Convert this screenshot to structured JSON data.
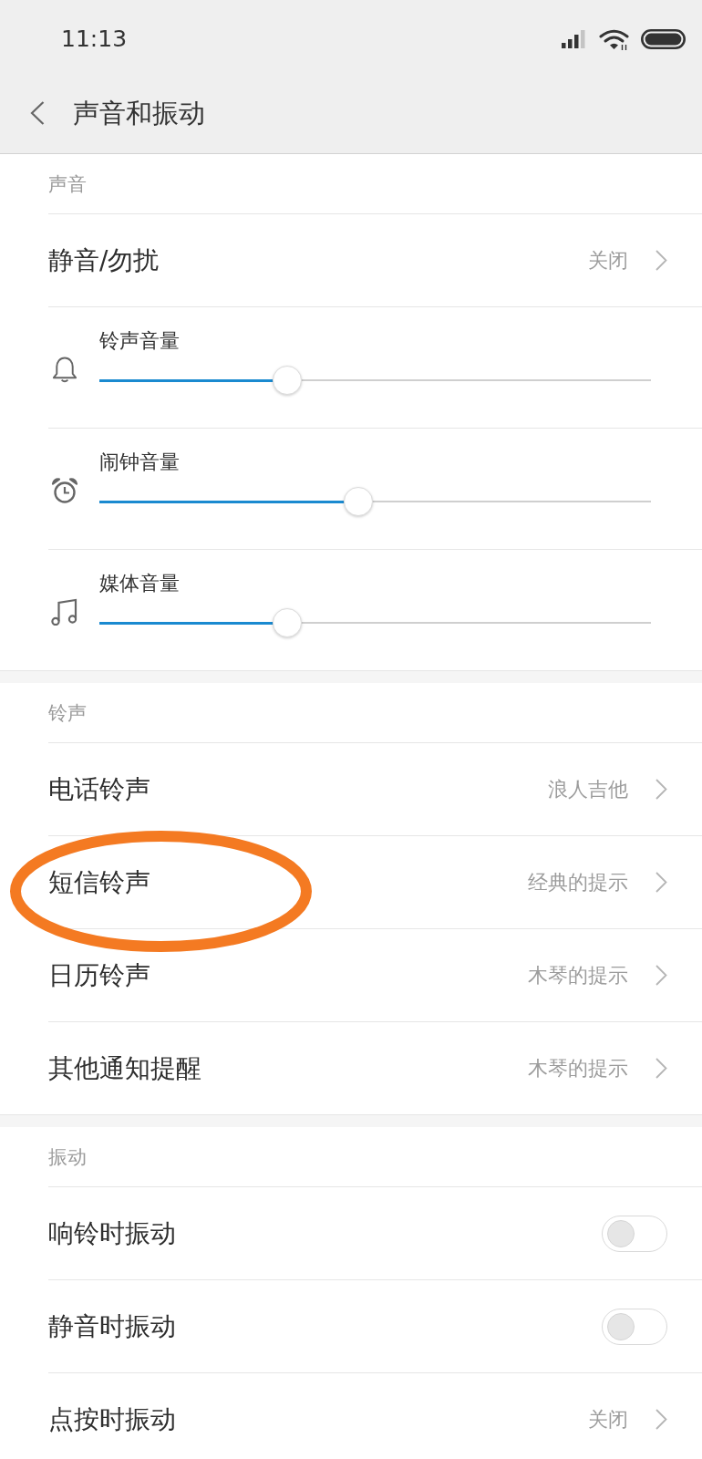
{
  "status_bar": {
    "time": "11:13"
  },
  "header": {
    "title": "声音和振动"
  },
  "sections": [
    {
      "title": "声音",
      "items": [
        {
          "kind": "link",
          "label": "静音/勿扰",
          "value": "关闭"
        },
        {
          "kind": "slider",
          "label": "铃声音量",
          "level": 0.34
        },
        {
          "kind": "slider",
          "label": "闹钟音量",
          "level": 0.47
        },
        {
          "kind": "slider",
          "label": "媒体音量",
          "level": 0.34
        }
      ]
    },
    {
      "title": "铃声",
      "items": [
        {
          "kind": "link",
          "label": "电话铃声",
          "value": "浪人吉他",
          "circled": false
        },
        {
          "kind": "link",
          "label": "短信铃声",
          "value": "经典的提示",
          "circled": true
        },
        {
          "kind": "link",
          "label": "日历铃声",
          "value": "木琴的提示",
          "circled": false
        },
        {
          "kind": "link",
          "label": "其他通知提醒",
          "value": "木琴的提示",
          "circled": false
        }
      ]
    },
    {
      "title": "振动",
      "items": [
        {
          "kind": "toggle",
          "label": "响铃时振动",
          "on": false
        },
        {
          "kind": "toggle",
          "label": "静音时振动",
          "on": false
        },
        {
          "kind": "link",
          "label": "点按时振动",
          "value": "关闭"
        }
      ]
    }
  ]
}
